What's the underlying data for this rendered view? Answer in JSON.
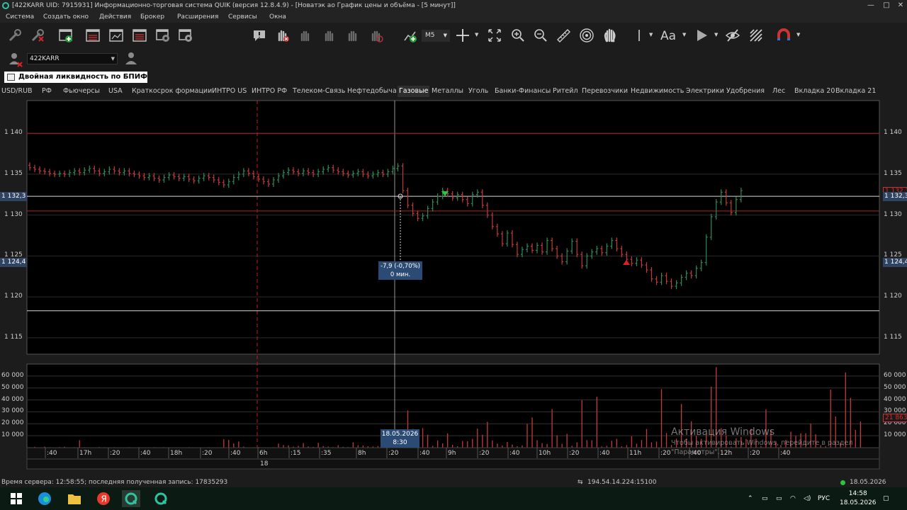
{
  "window": {
    "title": "[422KARR UID: 7915931] Информационно-торговая система QUIK (версия 12.8.4.9) - [Новатэк ао График цены и объёма - [5 минут]]",
    "controls": [
      "—",
      "□",
      "✕"
    ]
  },
  "menu": [
    "Система",
    "Создать окно",
    "Действия",
    "Брокер",
    "Расширения",
    "Сервисы",
    "Окна"
  ],
  "toolbar": {
    "interval_label": "M5",
    "icons": [
      "wrench-icon",
      "wrench-x-icon",
      "new-window-icon",
      "table-icon",
      "chart-window-icon",
      "list-icon",
      "transaction-icon",
      "settings-icon",
      "alert-icon",
      "stop-order-icon",
      "buy-hand-icon",
      "sell-hand-icon",
      "order-icon",
      "cancel-icon",
      "add-chart-icon",
      "crosshair-icon",
      "expand-icon",
      "zoom-in-icon",
      "zoom-out-icon",
      "ruler-icon",
      "target-icon",
      "pan-hand-icon",
      "line-tool-icon",
      "text-tool-icon",
      "shape-tool-icon",
      "eye-off-icon",
      "grid-icon",
      "magnet-icon"
    ]
  },
  "account": {
    "value": "422KARR"
  },
  "ribbon_label": "Двойная ликвидность по  БПИФ...",
  "tabs": [
    {
      "label": "USD/RUB",
      "active": false
    },
    {
      "label": "РФ",
      "active": false
    },
    {
      "label": "Фьючерсы",
      "active": false
    },
    {
      "label": "USA",
      "active": false
    },
    {
      "label": "Краткосрок формации",
      "active": false
    },
    {
      "label": "ИНТРО US",
      "active": false
    },
    {
      "label": "ИНТРО РФ",
      "active": false
    },
    {
      "label": "Телеком-Связь",
      "active": false
    },
    {
      "label": "Нефтедобыча",
      "active": false
    },
    {
      "label": "Газовые",
      "active": true
    },
    {
      "label": "Металлы",
      "active": false
    },
    {
      "label": "Уголь",
      "active": false
    },
    {
      "label": "Банки-Финансы",
      "active": false
    },
    {
      "label": "Ритейл",
      "active": false
    },
    {
      "label": "Перевозчики",
      "active": false
    },
    {
      "label": "Недвижимость",
      "active": false
    },
    {
      "label": "Электрики",
      "active": false
    },
    {
      "label": "Удобрения",
      "active": false
    },
    {
      "label": "Лес",
      "active": false
    },
    {
      "label": "Вкладка 20",
      "active": false
    },
    {
      "label": "Вкладка 21",
      "active": false
    }
  ],
  "chart": {
    "price_ticks": [
      "1 140",
      "1 135",
      "1 130",
      "1 125",
      "1 120",
      "1 115"
    ],
    "volume_ticks": [
      "60 000",
      "50 000",
      "40 000",
      "30 000",
      "20 000",
      "10 000"
    ],
    "left_price_boxes": [
      "1 132,3",
      "1 124,4"
    ],
    "right_price_boxes": [
      "1 132,3",
      "1 132,3",
      "1 124,4"
    ],
    "volume_box": "21 863",
    "measure_tooltip": [
      "-7,9 (-0,70%)",
      "0 мин."
    ],
    "cursor_date": [
      "18.05.2026",
      "8:30"
    ],
    "time_labels": [
      ":40",
      "17h",
      ":20",
      ":40",
      "18h",
      ":20",
      ":40",
      "6h",
      ":15",
      ":35",
      "8h",
      ":20",
      ":40",
      "9h",
      ":20",
      ":40",
      "10h",
      ":20",
      ":40",
      "11h",
      ":20",
      ":40",
      "12h",
      ":20",
      ":40"
    ],
    "day_label": "18",
    "colors": {
      "up": "#2e8b57",
      "down": "#c23b3b",
      "level_red": "#b22222",
      "level_white": "#d8d8d8"
    }
  },
  "chart_data": {
    "type": "candlestick",
    "instrument": "Новатэк ао",
    "interval": "5 минут",
    "ylim": [
      1113,
      1144
    ],
    "volume_ylim": [
      0,
      70000
    ],
    "levels": {
      "red": [
        1140,
        1130.5
      ],
      "white": [
        1132.3,
        1118.3
      ]
    },
    "close": [
      1135.8,
      1135.6,
      1135.4,
      1135.3,
      1135.1,
      1135.0,
      1135.1,
      1135.0,
      1135.2,
      1135.4,
      1135.2,
      1135.5,
      1135.7,
      1135.4,
      1135.1,
      1135.3,
      1135.6,
      1135.4,
      1135.2,
      1135.4,
      1135.1,
      1135.0,
      1134.8,
      1134.6,
      1134.8,
      1134.5,
      1134.3,
      1134.6,
      1134.9,
      1134.7,
      1134.5,
      1134.7,
      1134.4,
      1134.2,
      1134.5,
      1134.8,
      1134.6,
      1134.3,
      1134.0,
      1133.7,
      1134.1,
      1134.6,
      1135.0,
      1135.4,
      1135.1,
      1134.7,
      1134.4,
      1134.1,
      1133.8,
      1134.3,
      1134.8,
      1135.2,
      1135.5,
      1135.3,
      1135.1,
      1135.4,
      1135.2,
      1135.0,
      1135.3,
      1135.6,
      1135.8,
      1135.5,
      1135.3,
      1135.1,
      1134.9,
      1135.1,
      1135.3,
      1135.0,
      1134.8,
      1135.0,
      1135.2,
      1135.0,
      1135.3,
      1135.7,
      1136.0,
      1133.0,
      1131.2,
      1130.2,
      1129.6,
      1129.9,
      1130.8,
      1131.6,
      1132.3,
      1133.0,
      1132.6,
      1132.1,
      1132.5,
      1131.9,
      1131.4,
      1132.5,
      1132.8,
      1131.2,
      1130.0,
      1128.6,
      1127.7,
      1126.5,
      1127.8,
      1126.4,
      1125.2,
      1125.8,
      1126.2,
      1125.7,
      1126.3,
      1125.5,
      1126.9,
      1125.9,
      1125.0,
      1124.3,
      1125.6,
      1126.8,
      1125.2,
      1123.8,
      1125.0,
      1125.5,
      1125.9,
      1125.4,
      1126.2,
      1126.9,
      1125.9,
      1125.2,
      1124.6,
      1124.1,
      1124.5,
      1123.9,
      1123.3,
      1122.2,
      1121.8,
      1122.6,
      1121.9,
      1121.3,
      1121.7,
      1122.4,
      1122.9,
      1122.6,
      1123.5,
      1124.2,
      1127.3,
      1129.8,
      1131.6,
      1132.8,
      1131.5,
      1130.3,
      1131.9,
      1133.0
    ],
    "volumes": [
      400,
      700,
      300,
      900,
      400,
      300,
      500,
      800,
      300,
      400,
      6200,
      400,
      300,
      300,
      500,
      400,
      300,
      400,
      300,
      300,
      400,
      300,
      400,
      300,
      300,
      400,
      300,
      400,
      300,
      300,
      300,
      300,
      400,
      300,
      300,
      300,
      400,
      300,
      300,
      7000,
      6500,
      3500,
      5200,
      900,
      300,
      400,
      500,
      300,
      300,
      400,
      3400,
      2200,
      1900,
      900,
      1500,
      3800,
      1100,
      600,
      4000,
      1300,
      900,
      500,
      2000,
      700,
      500,
      4500,
      2000,
      1800,
      1200,
      1000,
      1300,
      2400,
      4800,
      9300,
      11800,
      12800,
      31200,
      15800,
      4800,
      16400,
      10800,
      1500,
      6100,
      3600,
      12000,
      2400,
      1200,
      5600,
      5400,
      7400,
      16000,
      10800,
      21600,
      6100,
      3400,
      1800,
      4800,
      2600,
      1200,
      1900,
      19900,
      25300,
      6300,
      3800,
      3100,
      32300,
      10400,
      3200,
      11500,
      1600,
      4500,
      39700,
      6400,
      6200,
      42600,
      1000,
      1600,
      5800,
      7400,
      1100,
      2200,
      9600,
      3300,
      6400,
      15600,
      4500,
      5100,
      49000,
      12300,
      2300,
      7500,
      36600,
      7600,
      22100,
      9900,
      7400,
      10800,
      51000,
      67400,
      16300,
      10300,
      1000,
      7900,
      8900,
      7200,
      15700,
      7500,
      1400,
      32000,
      14700,
      5100,
      2200,
      6500,
      13300,
      9900,
      12000,
      12100,
      20200,
      11200,
      2000,
      1300,
      48600,
      26100,
      4200,
      63000,
      41700,
      14900,
      21900
    ]
  },
  "status": {
    "server_text": "Время сервера: 12:58:55; последняя полученная запись: 17835293",
    "connection": "194.54.14.224:15100",
    "date": "18.05.2026"
  },
  "activation": {
    "title": "Активация Windows",
    "subtitle": "Чтобы активировать Windows, перейдите в раздел",
    "subtitle2": "\"Параметры\"."
  },
  "taskbar": {
    "language": "РУС",
    "time": "14:58",
    "date": "18.05.2026"
  }
}
